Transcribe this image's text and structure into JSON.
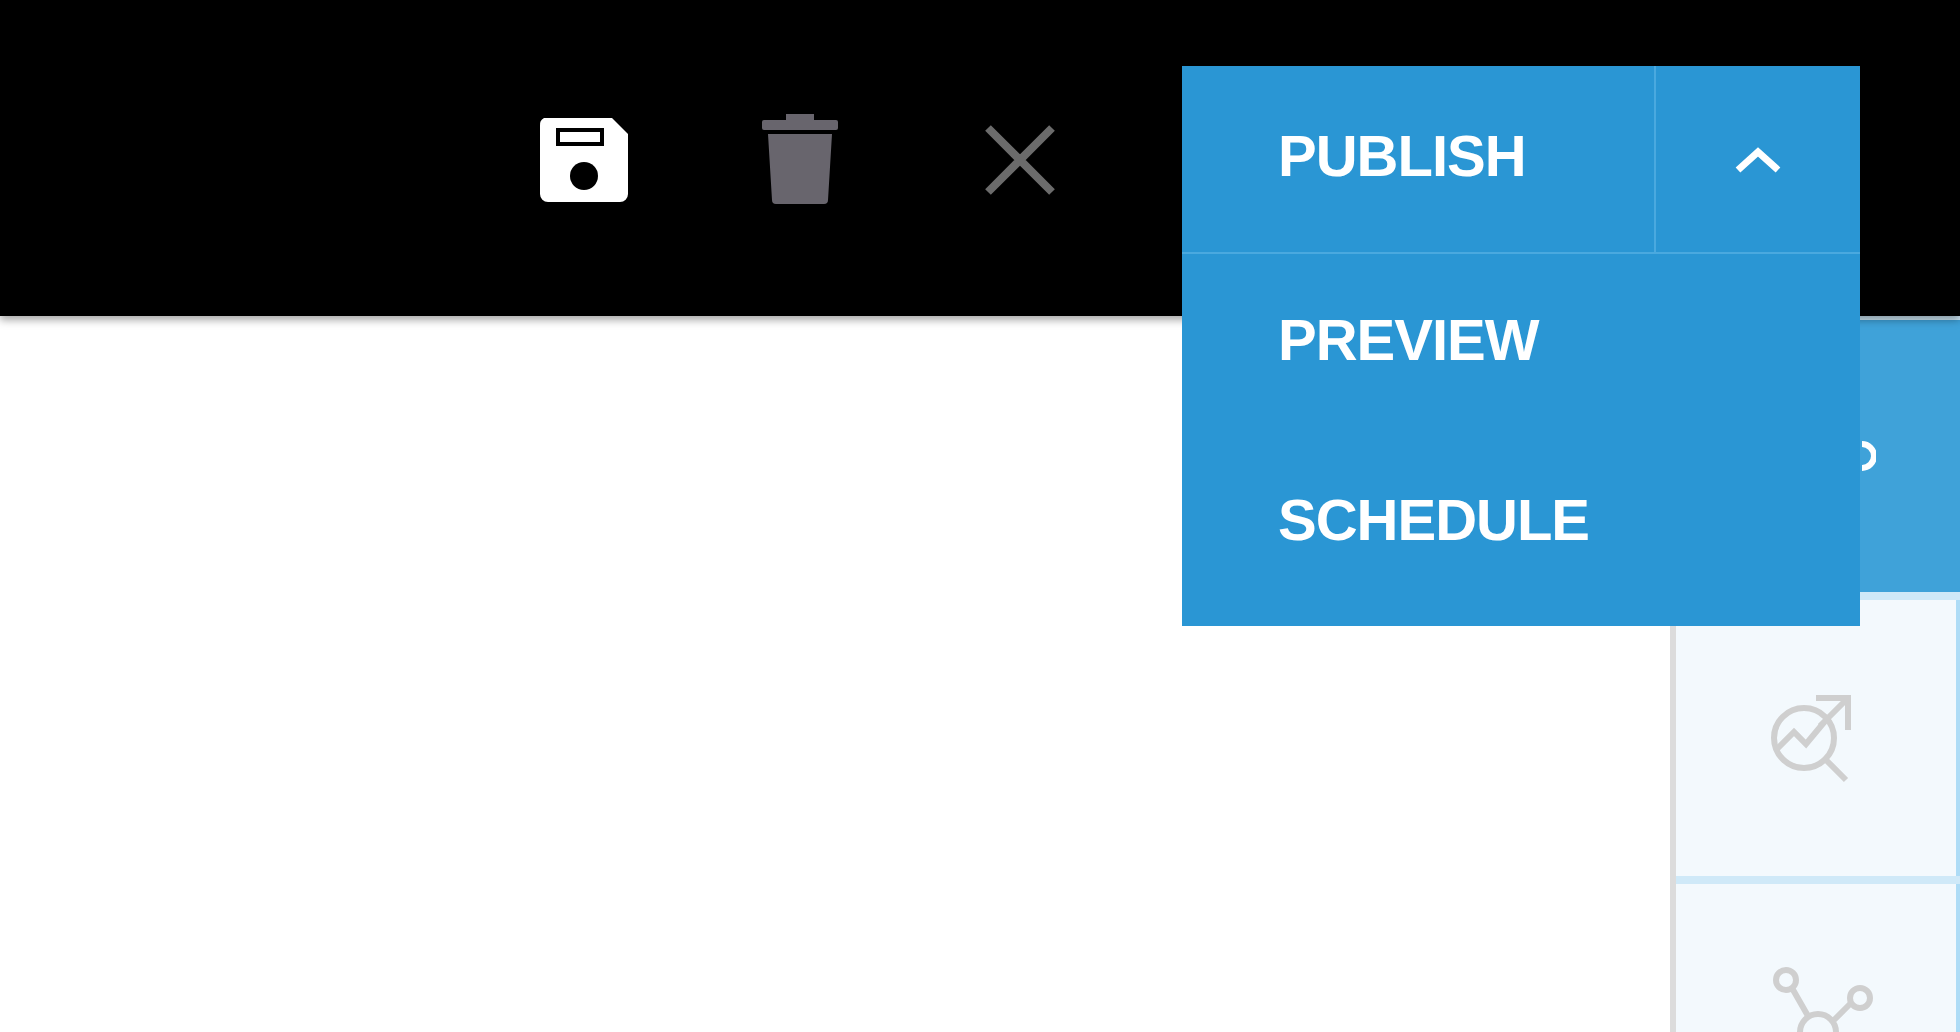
{
  "publish": {
    "label": "PUBLISH",
    "expanded": true,
    "menu": [
      {
        "label": "PREVIEW"
      },
      {
        "label": "SCHEDULE"
      }
    ]
  },
  "rail": [
    {
      "kind": "partial",
      "selected": true
    },
    {
      "kind": "analytics",
      "selected": false
    },
    {
      "kind": "share",
      "selected": false
    }
  ]
}
